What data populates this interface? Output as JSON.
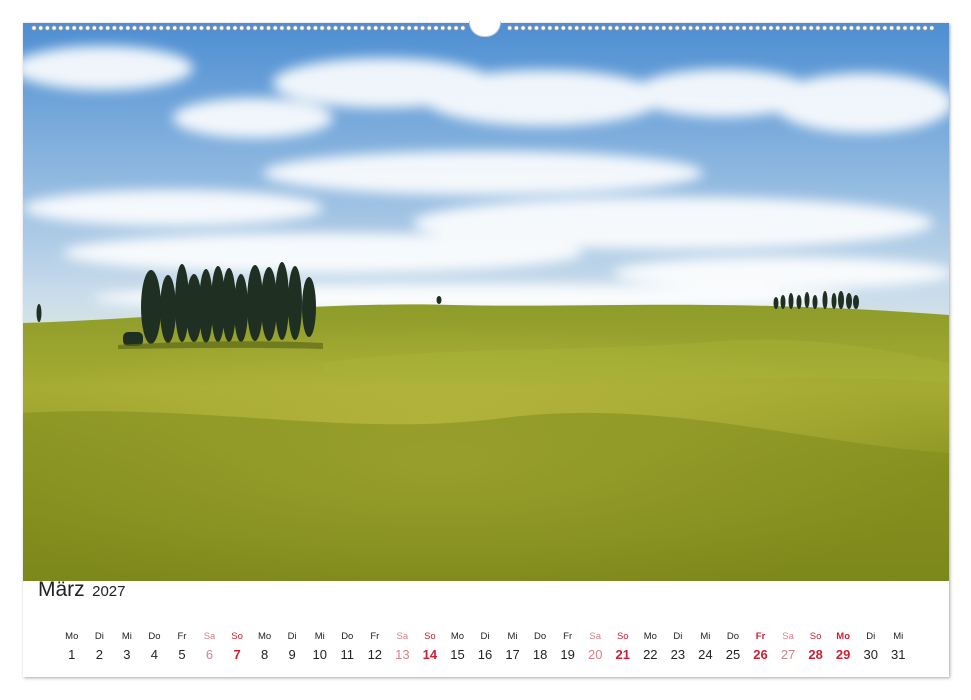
{
  "calendar": {
    "month": "März",
    "year": "2027",
    "days": [
      {
        "wd": "Mo",
        "d": "1",
        "type": "weekday"
      },
      {
        "wd": "Di",
        "d": "2",
        "type": "weekday"
      },
      {
        "wd": "Mi",
        "d": "3",
        "type": "weekday"
      },
      {
        "wd": "Do",
        "d": "4",
        "type": "weekday"
      },
      {
        "wd": "Fr",
        "d": "5",
        "type": "weekday"
      },
      {
        "wd": "Sa",
        "d": "6",
        "type": "sat"
      },
      {
        "wd": "So",
        "d": "7",
        "type": "sun"
      },
      {
        "wd": "Mo",
        "d": "8",
        "type": "weekday"
      },
      {
        "wd": "Di",
        "d": "9",
        "type": "weekday"
      },
      {
        "wd": "Mi",
        "d": "10",
        "type": "weekday"
      },
      {
        "wd": "Do",
        "d": "11",
        "type": "weekday"
      },
      {
        "wd": "Fr",
        "d": "12",
        "type": "weekday"
      },
      {
        "wd": "Sa",
        "d": "13",
        "type": "sat"
      },
      {
        "wd": "So",
        "d": "14",
        "type": "sun"
      },
      {
        "wd": "Mo",
        "d": "15",
        "type": "weekday"
      },
      {
        "wd": "Di",
        "d": "16",
        "type": "weekday"
      },
      {
        "wd": "Mi",
        "d": "17",
        "type": "weekday"
      },
      {
        "wd": "Do",
        "d": "18",
        "type": "weekday"
      },
      {
        "wd": "Fr",
        "d": "19",
        "type": "weekday"
      },
      {
        "wd": "Sa",
        "d": "20",
        "type": "sat"
      },
      {
        "wd": "So",
        "d": "21",
        "type": "sun"
      },
      {
        "wd": "Mo",
        "d": "22",
        "type": "weekday"
      },
      {
        "wd": "Di",
        "d": "23",
        "type": "weekday"
      },
      {
        "wd": "Mi",
        "d": "24",
        "type": "weekday"
      },
      {
        "wd": "Do",
        "d": "25",
        "type": "weekday"
      },
      {
        "wd": "Fr",
        "d": "26",
        "type": "hol"
      },
      {
        "wd": "Sa",
        "d": "27",
        "type": "sat"
      },
      {
        "wd": "So",
        "d": "28",
        "type": "sun"
      },
      {
        "wd": "Mo",
        "d": "29",
        "type": "hol"
      },
      {
        "wd": "Di",
        "d": "30",
        "type": "weekday"
      },
      {
        "wd": "Mi",
        "d": "31",
        "type": "weekday"
      }
    ]
  },
  "colors": {
    "weekday": "#222222",
    "saturday": "#d9808a",
    "sunday_holiday": "#cc1f33",
    "sky_top": "#4f8fd0",
    "meadow": "#8a9a1e"
  }
}
